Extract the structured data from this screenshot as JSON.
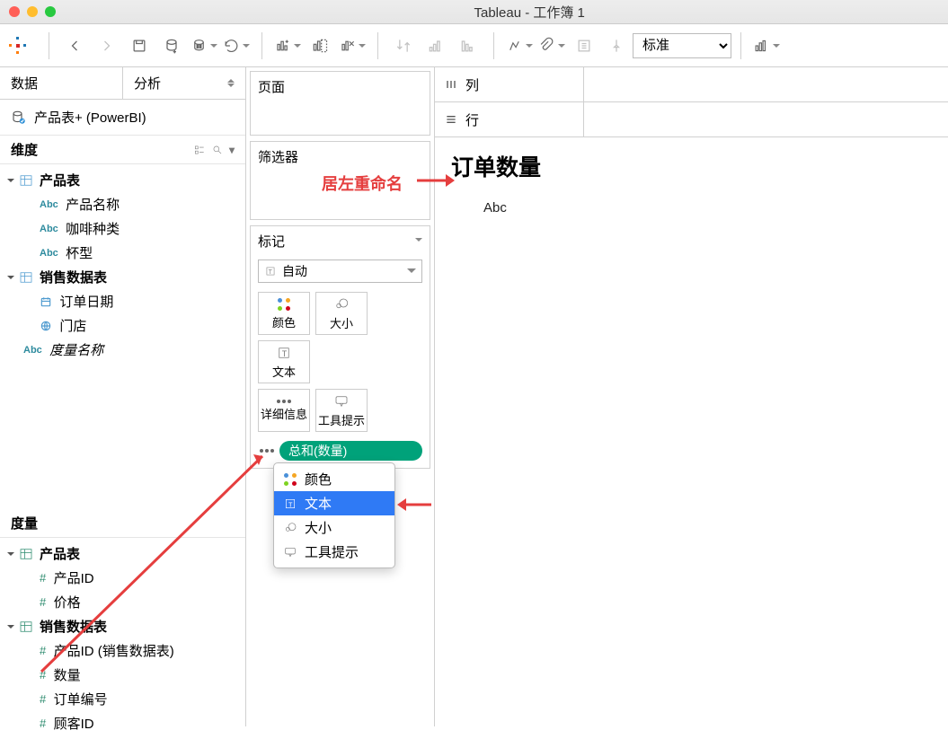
{
  "title": "Tableau - 工作簿 1",
  "toolbar": {
    "fit_label": "标准"
  },
  "sidebar": {
    "tab_data": "数据",
    "tab_analysis": "分析",
    "datasource": "产品表+ (PowerBI)",
    "dimensions_label": "维度",
    "measures_label": "度量",
    "dim_tree": {
      "product_table": "产品表",
      "product_name": "产品名称",
      "coffee_type": "咖啡种类",
      "cup_type": "杯型",
      "sales_table": "销售数据表",
      "order_date": "订单日期",
      "store": "门店",
      "measure_names": "度量名称"
    },
    "meas_tree": {
      "product_table": "产品表",
      "product_id": "产品ID",
      "price": "价格",
      "sales_table": "销售数据表",
      "product_id_sales": "产品ID (销售数据表)",
      "quantity": "数量",
      "order_no": "订单编号",
      "customer_id": "顾客ID"
    }
  },
  "shelves": {
    "pages": "页面",
    "filters": "筛选器",
    "marks": "标记",
    "mark_type": "自动",
    "color": "颜色",
    "size": "大小",
    "text": "文本",
    "detail": "详细信息",
    "tooltip": "工具提示",
    "pill": "总和(数量)"
  },
  "dropdown": {
    "color": "颜色",
    "text": "文本",
    "size": "大小",
    "tooltip": "工具提示"
  },
  "canvas": {
    "columns": "列",
    "rows": "行",
    "title": "订单数量",
    "cell": "Abc"
  },
  "annotation": {
    "rename_left": "居左重命名"
  }
}
